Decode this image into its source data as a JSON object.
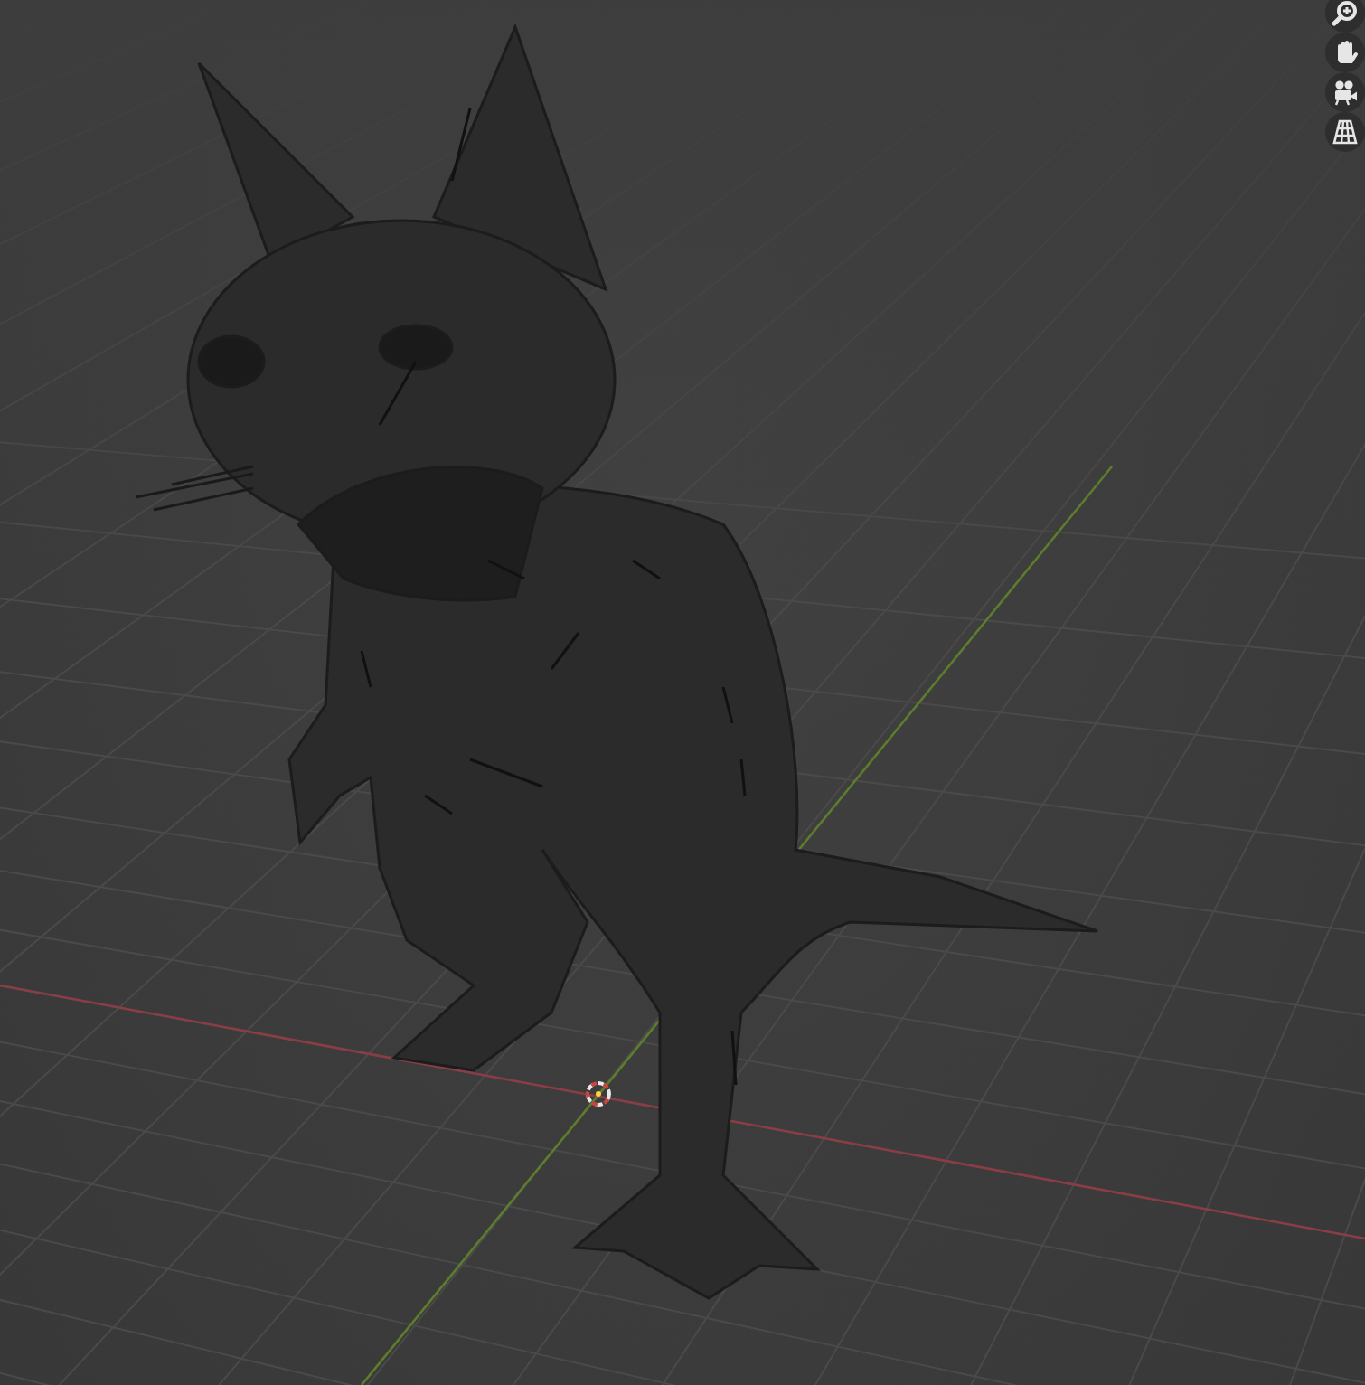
{
  "viewport": {
    "navigation_buttons": [
      {
        "kind": "zoom"
      },
      {
        "kind": "pan"
      },
      {
        "kind": "camera"
      },
      {
        "kind": "projection"
      }
    ]
  }
}
